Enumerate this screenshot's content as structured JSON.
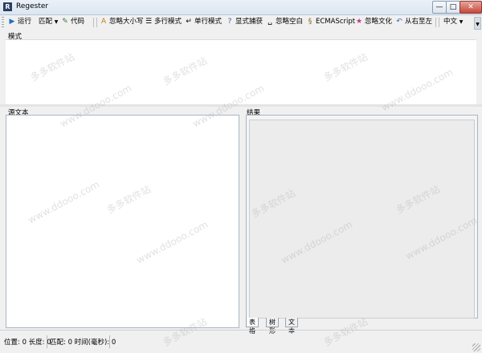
{
  "window": {
    "title": "Regester",
    "app_icon": "R"
  },
  "toolbar": {
    "run": "运行",
    "match": "匹配",
    "code": "代码",
    "ignore_case": "忽略大小写",
    "multiline": "多行模式",
    "singleline": "单行模式",
    "explicit_capture": "显式捕获",
    "ignore_whitespace": "忽略空白",
    "ecmascript": "ECMAScript",
    "ignore_culture": "忽略文化",
    "right_to_left": "从右至左",
    "language": "中文"
  },
  "pattern": {
    "label": "模式"
  },
  "source": {
    "label": "源文本"
  },
  "result": {
    "label": "结果",
    "tabs": [
      "表格",
      "树形",
      "文本"
    ]
  },
  "status": {
    "position": "位置: 0 长度: 0",
    "match": "匹配: 0 时间(毫秒): 0"
  },
  "watermarks": [
    "多多软件站",
    "www.ddooo.com"
  ]
}
